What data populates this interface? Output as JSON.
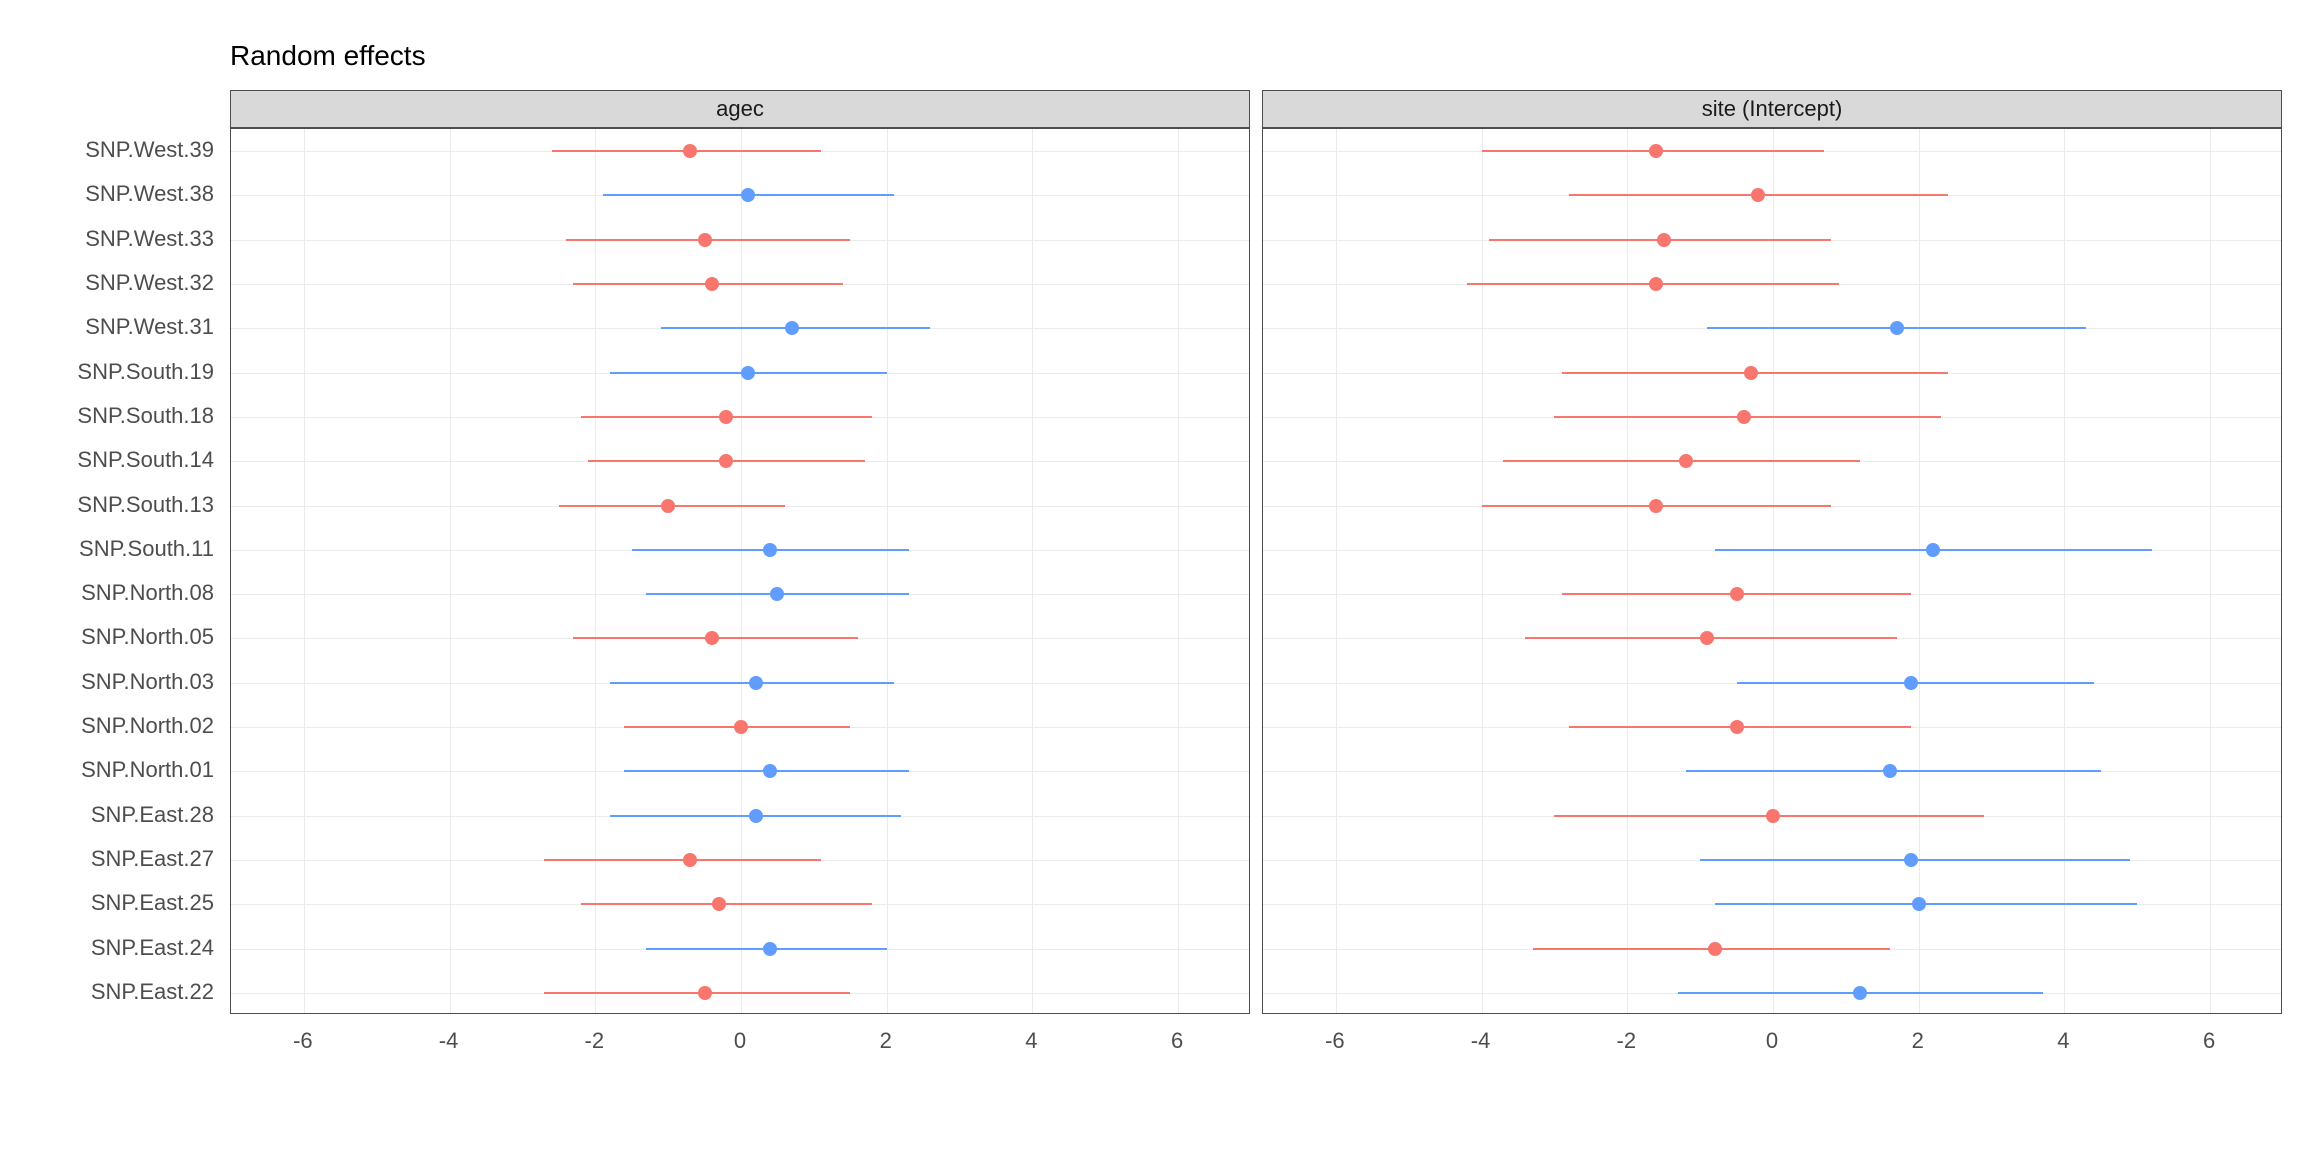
{
  "title": "Random effects",
  "colors": {
    "neg": "#f8766d",
    "pos": "#619cff"
  },
  "panels": [
    {
      "name": "agec",
      "label": "agec"
    },
    {
      "name": "site-intercept",
      "label": "site (Intercept)"
    }
  ],
  "x": {
    "min": -7,
    "max": 7,
    "ticks": [
      -6,
      -4,
      -2,
      0,
      2,
      4,
      6
    ]
  },
  "categories": [
    "SNP.West.39",
    "SNP.West.38",
    "SNP.West.33",
    "SNP.West.32",
    "SNP.West.31",
    "SNP.South.19",
    "SNP.South.18",
    "SNP.South.14",
    "SNP.South.13",
    "SNP.South.11",
    "SNP.North.08",
    "SNP.North.05",
    "SNP.North.03",
    "SNP.North.02",
    "SNP.North.01",
    "SNP.East.28",
    "SNP.East.27",
    "SNP.East.25",
    "SNP.East.24",
    "SNP.East.22"
  ],
  "chart_data": {
    "type": "forest",
    "title": "Random effects",
    "xlabel": "",
    "ylabel": "",
    "xlim": [
      -7,
      7
    ],
    "categories": [
      "SNP.West.39",
      "SNP.West.38",
      "SNP.West.33",
      "SNP.West.32",
      "SNP.West.31",
      "SNP.South.19",
      "SNP.South.18",
      "SNP.South.14",
      "SNP.South.13",
      "SNP.South.11",
      "SNP.North.08",
      "SNP.North.05",
      "SNP.North.03",
      "SNP.North.02",
      "SNP.North.01",
      "SNP.East.28",
      "SNP.East.27",
      "SNP.East.25",
      "SNP.East.24",
      "SNP.East.22"
    ],
    "series": [
      {
        "name": "agec",
        "values": [
          {
            "est": -0.7,
            "lo": -2.6,
            "hi": 1.1
          },
          {
            "est": 0.1,
            "lo": -1.9,
            "hi": 2.1
          },
          {
            "est": -0.5,
            "lo": -2.4,
            "hi": 1.5
          },
          {
            "est": -0.4,
            "lo": -2.3,
            "hi": 1.4
          },
          {
            "est": 0.7,
            "lo": -1.1,
            "hi": 2.6
          },
          {
            "est": 0.1,
            "lo": -1.8,
            "hi": 2.0
          },
          {
            "est": -0.2,
            "lo": -2.2,
            "hi": 1.8
          },
          {
            "est": -0.2,
            "lo": -2.1,
            "hi": 1.7
          },
          {
            "est": -1.0,
            "lo": -2.5,
            "hi": 0.6
          },
          {
            "est": 0.4,
            "lo": -1.5,
            "hi": 2.3
          },
          {
            "est": 0.5,
            "lo": -1.3,
            "hi": 2.3
          },
          {
            "est": -0.4,
            "lo": -2.3,
            "hi": 1.6
          },
          {
            "est": 0.2,
            "lo": -1.8,
            "hi": 2.1
          },
          {
            "est": 0.0,
            "lo": -1.6,
            "hi": 1.5
          },
          {
            "est": 0.4,
            "lo": -1.6,
            "hi": 2.3
          },
          {
            "est": 0.2,
            "lo": -1.8,
            "hi": 2.2
          },
          {
            "est": -0.7,
            "lo": -2.7,
            "hi": 1.1
          },
          {
            "est": -0.3,
            "lo": -2.2,
            "hi": 1.8
          },
          {
            "est": 0.4,
            "lo": -1.3,
            "hi": 2.0
          },
          {
            "est": -0.5,
            "lo": -2.7,
            "hi": 1.5
          }
        ]
      },
      {
        "name": "site (Intercept)",
        "values": [
          {
            "est": -1.6,
            "lo": -4.0,
            "hi": 0.7
          },
          {
            "est": -0.2,
            "lo": -2.8,
            "hi": 2.4
          },
          {
            "est": -1.5,
            "lo": -3.9,
            "hi": 0.8
          },
          {
            "est": -1.6,
            "lo": -4.2,
            "hi": 0.9
          },
          {
            "est": 1.7,
            "lo": -0.9,
            "hi": 4.3
          },
          {
            "est": -0.3,
            "lo": -2.9,
            "hi": 2.4
          },
          {
            "est": -0.4,
            "lo": -3.0,
            "hi": 2.3
          },
          {
            "est": -1.2,
            "lo": -3.7,
            "hi": 1.2
          },
          {
            "est": -1.6,
            "lo": -4.0,
            "hi": 0.8
          },
          {
            "est": 2.2,
            "lo": -0.8,
            "hi": 5.2
          },
          {
            "est": -0.5,
            "lo": -2.9,
            "hi": 1.9
          },
          {
            "est": -0.9,
            "lo": -3.4,
            "hi": 1.7
          },
          {
            "est": 1.9,
            "lo": -0.5,
            "hi": 4.4
          },
          {
            "est": -0.5,
            "lo": -2.8,
            "hi": 1.9
          },
          {
            "est": 1.6,
            "lo": -1.2,
            "hi": 4.5
          },
          {
            "est": 0.0,
            "lo": -3.0,
            "hi": 2.9
          },
          {
            "est": 1.9,
            "lo": -1.0,
            "hi": 4.9
          },
          {
            "est": 2.0,
            "lo": -0.8,
            "hi": 5.0
          },
          {
            "est": -0.8,
            "lo": -3.3,
            "hi": 1.6
          },
          {
            "est": 1.2,
            "lo": -1.3,
            "hi": 3.7
          }
        ]
      }
    ]
  }
}
